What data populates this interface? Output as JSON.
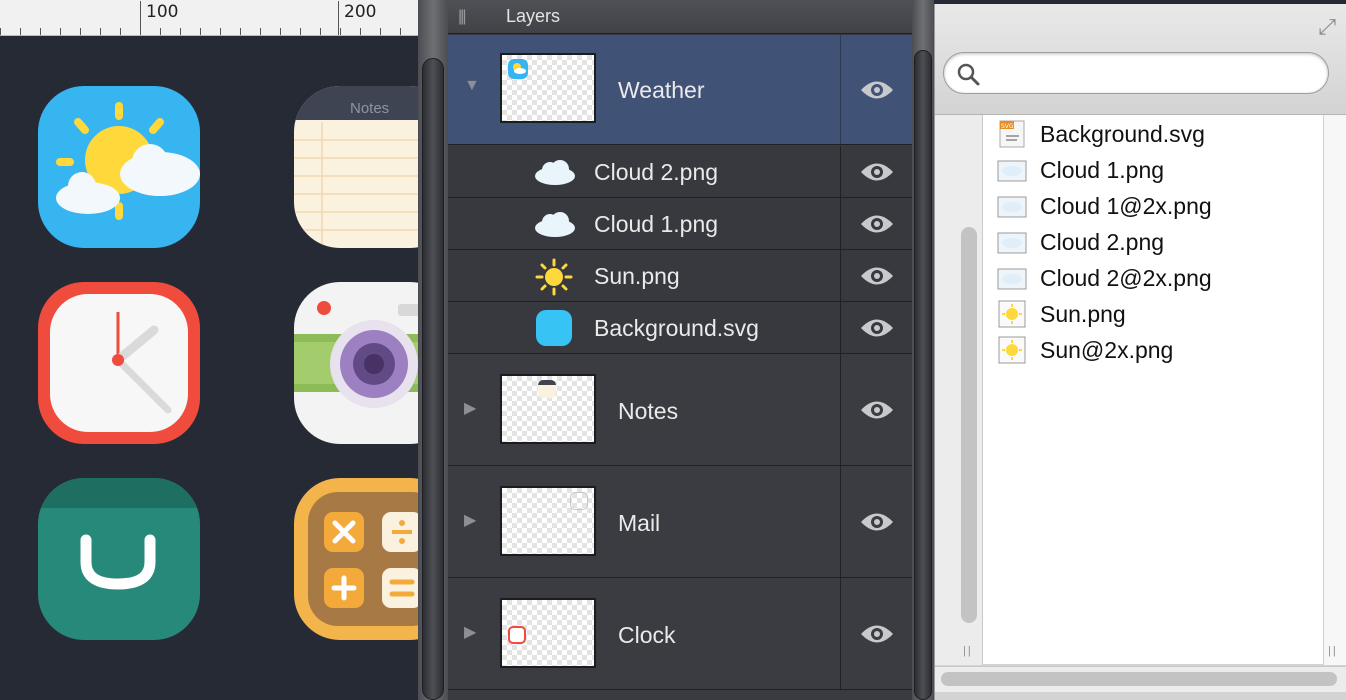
{
  "ruler": {
    "labels": [
      "100",
      "200"
    ]
  },
  "canvas": {
    "icons": [
      "weather-app-icon",
      "notes-app-icon",
      "clock-app-icon",
      "camera-app-icon",
      "store-app-icon",
      "calculator-app-icon"
    ],
    "notes_icon_label": "Notes"
  },
  "layers": {
    "title": "Layers",
    "groups": [
      {
        "name": "Weather",
        "expanded": true,
        "selected": true,
        "children": [
          {
            "name": "Cloud 2.png",
            "icon": "cloud-icon"
          },
          {
            "name": "Cloud 1.png",
            "icon": "cloud-icon"
          },
          {
            "name": "Sun.png",
            "icon": "sun-icon"
          },
          {
            "name": "Background.svg",
            "icon": "rounded-square-icon"
          }
        ]
      },
      {
        "name": "Notes",
        "expanded": false
      },
      {
        "name": "Mail",
        "expanded": false
      },
      {
        "name": "Clock",
        "expanded": false
      }
    ]
  },
  "files": {
    "search": {
      "value": "",
      "placeholder": ""
    },
    "items": [
      {
        "name": "Background.svg",
        "icon": "svg-file-icon"
      },
      {
        "name": "Cloud 1.png",
        "icon": "cloud-image-icon"
      },
      {
        "name": "Cloud 1@2x.png",
        "icon": "cloud-image-icon"
      },
      {
        "name": "Cloud 2.png",
        "icon": "cloud-image-icon"
      },
      {
        "name": "Cloud 2@2x.png",
        "icon": "cloud-image-icon"
      },
      {
        "name": "Sun.png",
        "icon": "sun-image-icon"
      },
      {
        "name": "Sun@2x.png",
        "icon": "sun-image-icon"
      }
    ]
  },
  "colors": {
    "selection": "#405275",
    "canvas_bg": "#262a35",
    "accent_blue": "#37b5f0"
  }
}
